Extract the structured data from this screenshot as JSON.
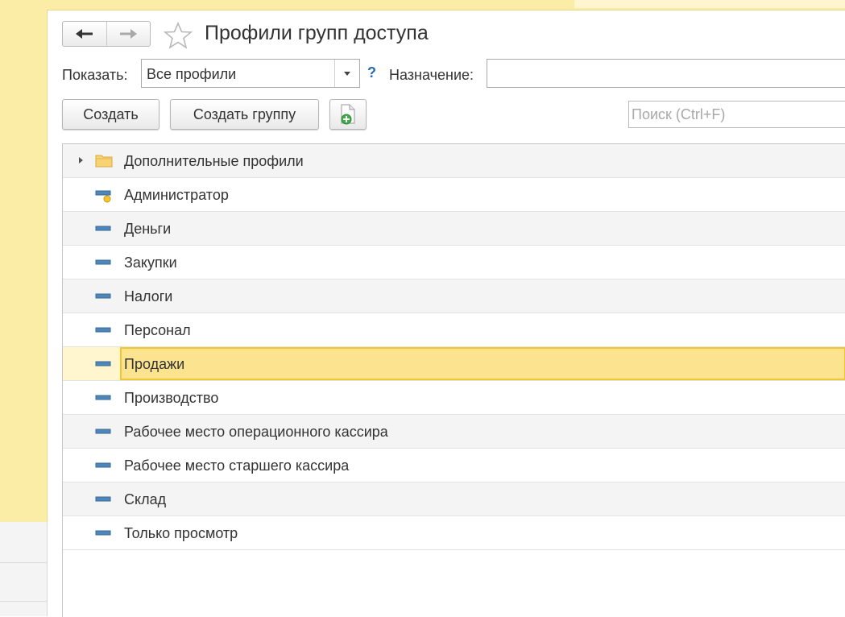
{
  "header": {
    "title": "Профили групп доступа",
    "back_icon": "arrow-left-icon",
    "forward_icon": "arrow-right-icon",
    "favorite_icon": "star-icon"
  },
  "filter": {
    "show_label": "Показать:",
    "show_value": "Все профили",
    "help": "?",
    "purpose_label": "Назначение:",
    "purpose_value": ""
  },
  "toolbar": {
    "create_label": "Создать",
    "create_group_label": "Создать группу",
    "add_copy_icon": "document-add-icon",
    "search_placeholder": "Поиск (Ctrl+F)"
  },
  "list": {
    "items": [
      {
        "label": "Дополнительные профили",
        "icon": "folder-icon",
        "expandable": true,
        "selected": false
      },
      {
        "label": "Администратор",
        "icon": "predefined-profile-icon",
        "expandable": false,
        "selected": false
      },
      {
        "label": "Деньги",
        "icon": "profile-icon",
        "expandable": false,
        "selected": false
      },
      {
        "label": "Закупки",
        "icon": "profile-icon",
        "expandable": false,
        "selected": false
      },
      {
        "label": "Налоги",
        "icon": "profile-icon",
        "expandable": false,
        "selected": false
      },
      {
        "label": "Персонал",
        "icon": "profile-icon",
        "expandable": false,
        "selected": false
      },
      {
        "label": "Продажи",
        "icon": "profile-icon",
        "expandable": false,
        "selected": true
      },
      {
        "label": "Производство",
        "icon": "profile-icon",
        "expandable": false,
        "selected": false
      },
      {
        "label": "Рабочее место операционного кассира",
        "icon": "profile-icon",
        "expandable": false,
        "selected": false
      },
      {
        "label": "Рабочее место старшего кассира",
        "icon": "profile-icon",
        "expandable": false,
        "selected": false
      },
      {
        "label": "Склад",
        "icon": "profile-icon",
        "expandable": false,
        "selected": false
      },
      {
        "label": "Только просмотр",
        "icon": "profile-icon",
        "expandable": false,
        "selected": false
      }
    ]
  },
  "colors": {
    "panel_yellow": "#fbeca6",
    "selection_fill": "#fbe38f",
    "selection_border": "#f1c62f",
    "help_blue": "#2a6ab3",
    "profile_icon_blue": "#4f86b8"
  }
}
